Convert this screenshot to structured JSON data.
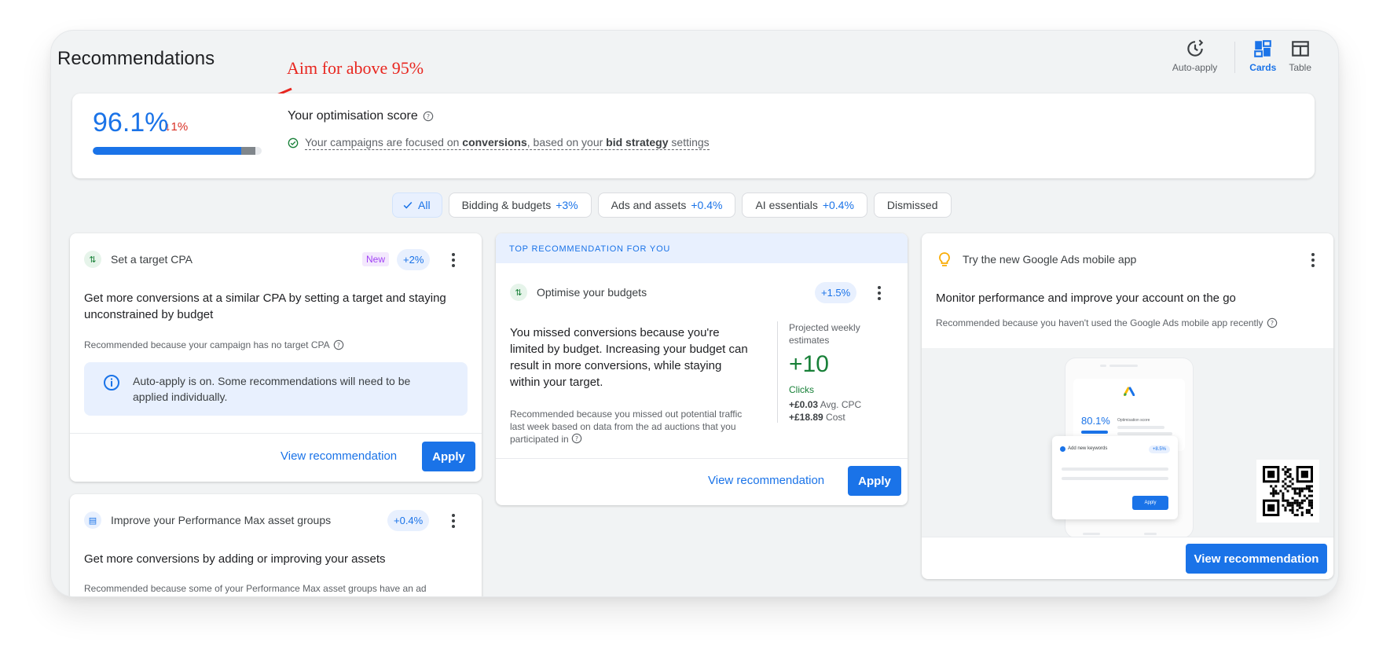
{
  "header": {
    "title": "Recommendations"
  },
  "annotation": {
    "text": "Aim for above 95%"
  },
  "view_switch": {
    "auto_apply": "Auto-apply",
    "cards": "Cards",
    "table": "Table",
    "active": "cards"
  },
  "score": {
    "value": "96.1%",
    "value_fraction": 0.961,
    "delta": "↓1%",
    "delta_fraction": 0.01,
    "heading": "Your optimisation score",
    "desc_prefix": "Your campaigns are focused on ",
    "desc_bold1": "conversions",
    "desc_mid": ", based on your ",
    "desc_bold2": "bid strategy",
    "desc_suffix": " settings"
  },
  "filters": [
    {
      "label": "All",
      "pct": "",
      "selected": true
    },
    {
      "label": "Bidding & budgets",
      "pct": "+3%"
    },
    {
      "label": "Ads and assets",
      "pct": "+0.4%"
    },
    {
      "label": "AI essentials",
      "pct": "+0.4%"
    },
    {
      "label": "Dismissed",
      "pct": ""
    }
  ],
  "card_cpa": {
    "name": "Set a target CPA",
    "badge_new": "New",
    "badge_pct": "+2%",
    "title": "Get more conversions at a similar CPA by setting a target and staying unconstrained by budget",
    "reason": "Recommended because your campaign has no target CPA",
    "info": "Auto-apply is on. Some recommendations will need to be applied individually.",
    "view": "View recommendation",
    "apply": "Apply"
  },
  "card_pmax": {
    "name": "Improve your Performance Max asset groups",
    "badge_pct": "+0.4%",
    "title": "Get more conversions by adding or improving your assets",
    "reason": "Recommended because some of your Performance Max asset groups have an ad"
  },
  "card_budget": {
    "strip": "TOP RECOMMENDATION FOR YOU",
    "name": "Optimise your budgets",
    "badge_pct": "+1.5%",
    "title": "You missed conversions because you're limited by budget. Increasing your budget can result in more conversions, while staying within your target.",
    "reason": "Recommended because you missed out potential traffic last week based on data from the ad auctions that you participated in",
    "proj_label": "Projected weekly estimates",
    "proj_value": "+10",
    "proj_unit": "Clicks",
    "cpc_value": "+£0.03",
    "cpc_label": " Avg. CPC",
    "cost_value": "+£18.89",
    "cost_label": " Cost",
    "view": "View recommendation",
    "apply": "Apply"
  },
  "card_app": {
    "name": "Try the new Google Ads mobile app",
    "title": "Monitor performance and improve your account on the go",
    "reason": "Recommended because you haven't used the Google Ads mobile app recently",
    "mock_score": "80.1%",
    "mock_label": "Optimisation score",
    "mock_card_title": "Add new keywords",
    "mock_pct": "+8.5%",
    "mock_apply": "Apply",
    "view": "View recommendation"
  },
  "colors": {
    "accent": "#1a73e8",
    "positive": "#188038",
    "negative": "#d93025",
    "annotation": "#e8261f"
  }
}
